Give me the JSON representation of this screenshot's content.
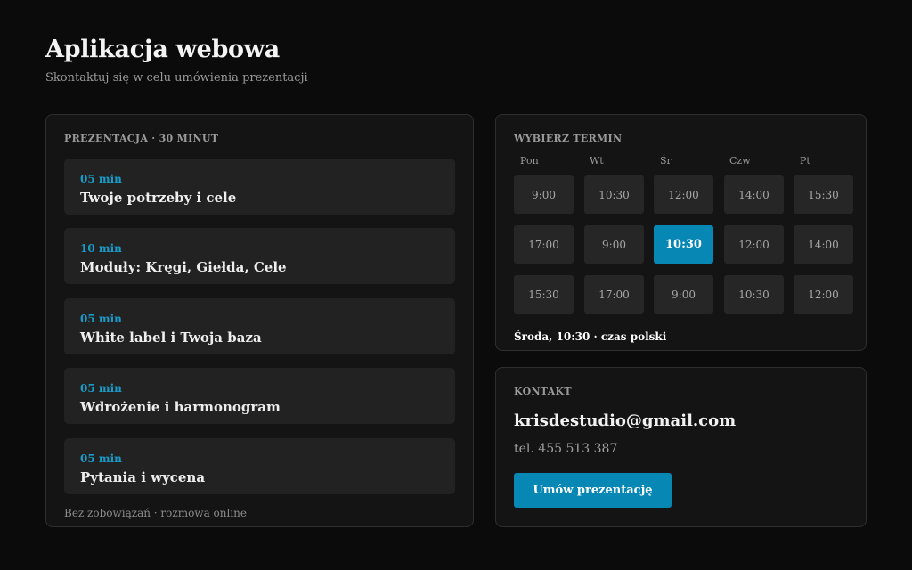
{
  "header": {
    "title": "Aplikacja webowa",
    "subtitle": "Skontaktuj się w celu umówienia prezentacji"
  },
  "agenda": {
    "label": "PREZENTACJA · 30 MINUT",
    "items": [
      {
        "duration": "05 min",
        "title": "Twoje potrzeby i cele"
      },
      {
        "duration": "10 min",
        "title": "Moduły: Kręgi, Giełda, Cele"
      },
      {
        "duration": "05 min",
        "title": "White label i Twoja baza"
      },
      {
        "duration": "05 min",
        "title": "Wdrożenie i harmonogram"
      },
      {
        "duration": "05 min",
        "title": "Pytania i wycena"
      }
    ],
    "footnote": "Bez zobowiązań · rozmowa online"
  },
  "schedule": {
    "label": "WYBIERZ TERMIN",
    "days": [
      "Pon",
      "Wt",
      "Śr",
      "Czw",
      "Pt"
    ],
    "rows": [
      [
        "9:00",
        "10:30",
        "12:00",
        "14:00",
        "15:30"
      ],
      [
        "17:00",
        "9:00",
        "10:30",
        "12:00",
        "14:00"
      ],
      [
        "15:30",
        "17:00",
        "9:00",
        "10:30",
        "12:00"
      ]
    ],
    "selected": {
      "row": 1,
      "col": 2
    },
    "summary": "Środa, 10:30 · czas polski"
  },
  "contact": {
    "label": "KONTAKT",
    "email": "krisdestudio@gmail.com",
    "phone": "tel. 455 513 387",
    "button_label": "Umów prezentację"
  },
  "colors": {
    "accent": "#0787b4",
    "background": "#0b0b0b",
    "card": "#141414"
  }
}
